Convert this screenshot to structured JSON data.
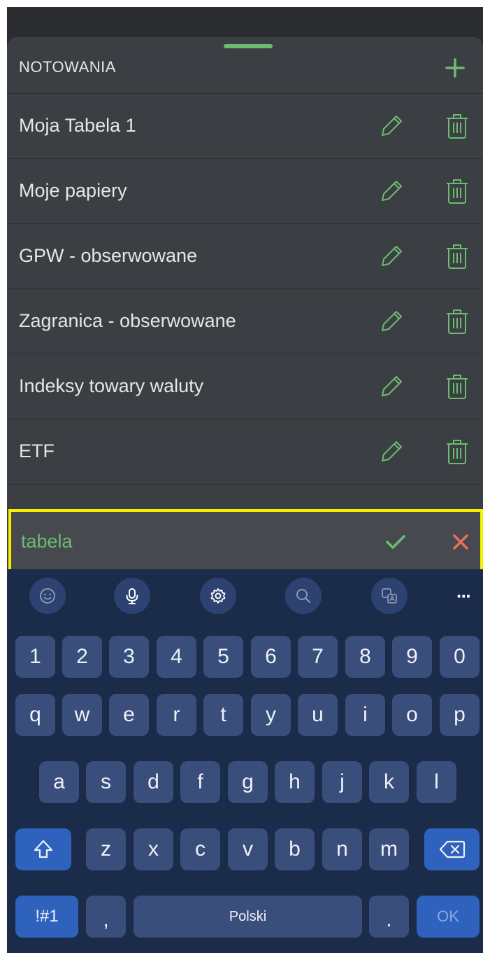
{
  "sheet": {
    "title": "NOTOWANIA",
    "items": [
      {
        "label": "Moja Tabela 1"
      },
      {
        "label": "Moje papiery"
      },
      {
        "label": "GPW - obserwowane"
      },
      {
        "label": "Zagranica - obserwowane"
      },
      {
        "label": "Indeksy towary waluty"
      },
      {
        "label": "ETF"
      }
    ],
    "edit": {
      "value": "tabela"
    }
  },
  "colors": {
    "accent_green": "#6dbb72",
    "cancel_red": "#e8705a",
    "highlight_yellow": "#f5ef00",
    "sheet_bg": "#3b3e42",
    "keyboard_bg": "#1b2b4a",
    "key_bg": "#3a4e7b",
    "special_key_bg": "#2f62bd"
  },
  "keyboard": {
    "toolbar": [
      "emoji-icon",
      "microphone-icon",
      "gear-icon",
      "search-icon",
      "translate-icon",
      "more-icon"
    ],
    "more_label": "···",
    "numbers": [
      "1",
      "2",
      "3",
      "4",
      "5",
      "6",
      "7",
      "8",
      "9",
      "0"
    ],
    "row1": [
      "q",
      "w",
      "e",
      "r",
      "t",
      "y",
      "u",
      "i",
      "o",
      "p"
    ],
    "row2": [
      "a",
      "s",
      "d",
      "f",
      "g",
      "h",
      "j",
      "k",
      "l"
    ],
    "row3": [
      "z",
      "x",
      "c",
      "v",
      "b",
      "n",
      "m"
    ],
    "bottom": {
      "symbols": "!#1",
      "comma": ",",
      "space": "Polski",
      "period": ".",
      "ok": "OK"
    }
  }
}
